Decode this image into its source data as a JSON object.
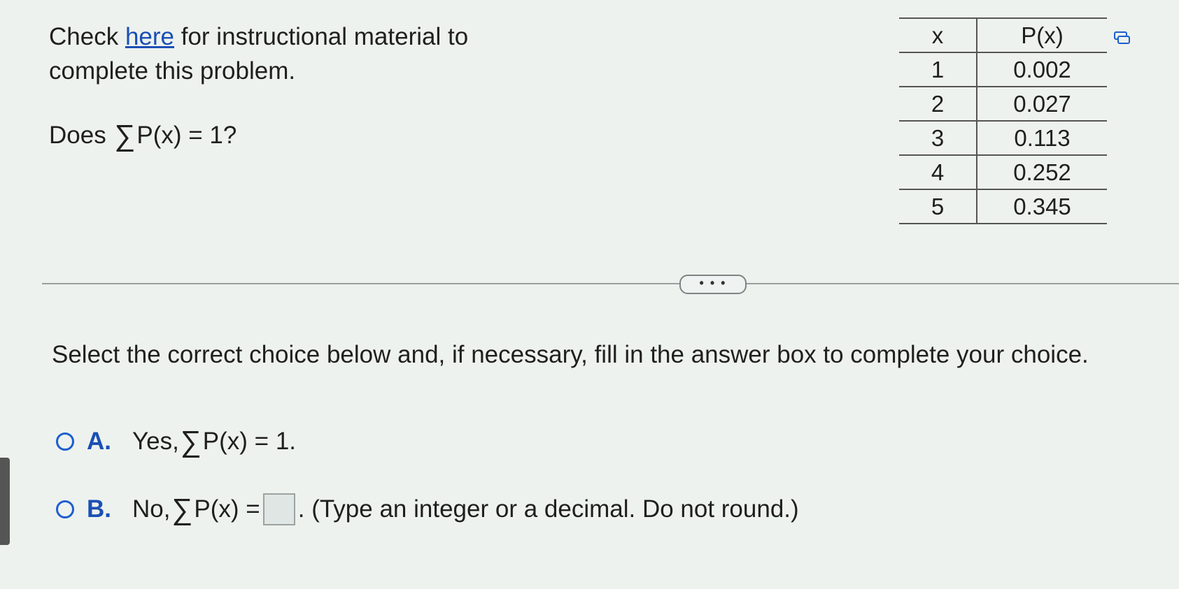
{
  "intro": {
    "before": "Check ",
    "link": "here",
    "after_line1": " for instructional material to",
    "line2": "complete this problem."
  },
  "question": {
    "before": "Does ",
    "sigma": "∑",
    "after": "P(x) = 1?"
  },
  "table": {
    "headers": [
      "x",
      "P(x)"
    ],
    "rows": [
      [
        "1",
        "0.002"
      ],
      [
        "2",
        "0.027"
      ],
      [
        "3",
        "0.113"
      ],
      [
        "4",
        "0.252"
      ],
      [
        "5",
        "0.345"
      ]
    ]
  },
  "more_button": "• • •",
  "instruction": "Select the correct choice below and, if necessary, fill in the answer box to complete your choice.",
  "choices": {
    "a": {
      "letter": "A.",
      "before": "Yes, ",
      "sigma": "∑",
      "after": "P(x) = 1."
    },
    "b": {
      "letter": "B.",
      "before": "No, ",
      "sigma": "∑",
      "mid": "P(x) = ",
      "after": ". (Type an integer or a decimal. Do not round.)"
    }
  },
  "icons": {
    "copy": "copy-icon"
  },
  "colors": {
    "link": "#1a4fb5",
    "radio": "#1c5fd0"
  }
}
